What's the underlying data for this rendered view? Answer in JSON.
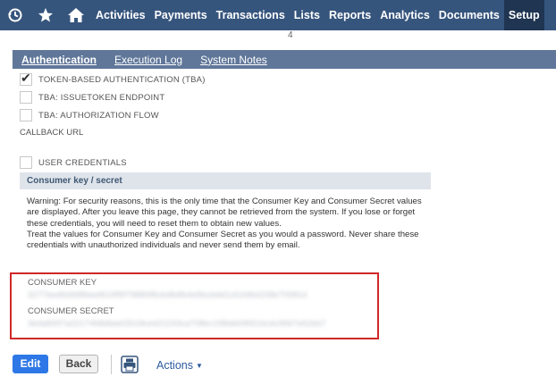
{
  "nav": {
    "icons": [
      "history-icon",
      "star-icon",
      "home-icon"
    ],
    "items": [
      "Activities",
      "Payments",
      "Transactions",
      "Lists",
      "Reports",
      "Analytics",
      "Documents",
      "Setup"
    ],
    "active": "Setup"
  },
  "page_indicator": "4",
  "tabs": [
    "Authentication",
    "Execution Log",
    "System Notes"
  ],
  "checkboxes": [
    {
      "label": "TOKEN-BASED AUTHENTICATION (TBA)",
      "checked": true
    },
    {
      "label": "TBA: ISSUETOKEN ENDPOINT",
      "checked": false
    },
    {
      "label": "TBA: AUTHORIZATION FLOW",
      "checked": false
    }
  ],
  "callback_label": "CALLBACK URL",
  "user_credentials": {
    "label": "USER CREDENTIALS",
    "checked": false
  },
  "section": {
    "title": "Consumer key / secret",
    "warning_1": "Warning: For security reasons, this is the only time that the Consumer Key and Consumer Secret values are displayed. After you leave this page, they cannot be retrieved from the system. If you lose or forget these credentials, you will need to reset them to obtain new values.",
    "warning_2": "Treat the values for Consumer Key and Consumer Secret as you would a password. Never share these credentials with unauthorized individuals and never send them by email."
  },
  "credentials": {
    "key_label": "CONSUMER KEY",
    "key_value": "3277bedfd468fbeef619f9f79880f8cbd8dfb4e5bcbdd1c61fd6d158e705814",
    "secret_label": "CONSUMER SECRET",
    "secret_value": "3eda8497a2217468dbeef2b18ced21193ca708ec198deb9651bcdc9667e62eb7"
  },
  "buttons": {
    "edit": "Edit",
    "back": "Back",
    "actions": "Actions"
  },
  "colors": {
    "nav_bg": "#36557d",
    "tab_bg": "#607799",
    "edit_bg": "#2d78e6",
    "highlight_border": "#d02828"
  }
}
